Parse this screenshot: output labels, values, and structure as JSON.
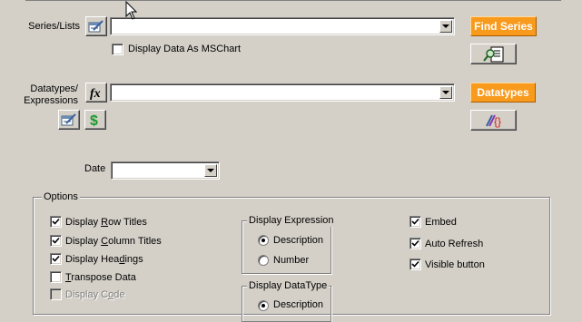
{
  "series": {
    "label": "Series/Lists",
    "value": "",
    "show_mschart_label": "Display Data As MSChart",
    "show_mschart_checked": false,
    "find_button": "Find Series"
  },
  "datatypes": {
    "label_line1": "Datatypes/",
    "label_line2": "Expressions",
    "value": "",
    "button": "Datatypes"
  },
  "date": {
    "label": "Date",
    "value": ""
  },
  "options": {
    "title": "Options",
    "checks": [
      {
        "pre": "Display ",
        "key": "R",
        "post": "ow Titles",
        "checked": true,
        "disabled": false
      },
      {
        "pre": "Display ",
        "key": "C",
        "post": "olumn Titles",
        "checked": true,
        "disabled": false
      },
      {
        "pre": "Display Hea",
        "key": "d",
        "post": "ings",
        "checked": true,
        "disabled": false
      },
      {
        "pre": "",
        "key": "T",
        "post": "ranspose Data",
        "checked": false,
        "disabled": false
      },
      {
        "pre": "Display C",
        "key": "o",
        "post": "de",
        "checked": false,
        "disabled": true
      }
    ],
    "display_expression": {
      "title": "Display Expression",
      "options": [
        "Description",
        "Number"
      ],
      "selected": 0
    },
    "display_datatype": {
      "title": "Display DataType",
      "options": [
        "Description"
      ],
      "selected": 0
    },
    "right_checks": [
      {
        "label": "Embed",
        "checked": true
      },
      {
        "label": "Auto Refresh",
        "checked": true
      },
      {
        "label": "Visible button",
        "checked": true
      }
    ]
  },
  "colors": {
    "face": "#d4d0c8",
    "accent": "#f89a1c"
  },
  "icons": [
    "edit-list-icon",
    "function-fx-icon",
    "edit-expression-icon",
    "dollar-icon",
    "find-preview-icon",
    "datatype-formula-icon",
    "mouse-cursor-icon"
  ]
}
